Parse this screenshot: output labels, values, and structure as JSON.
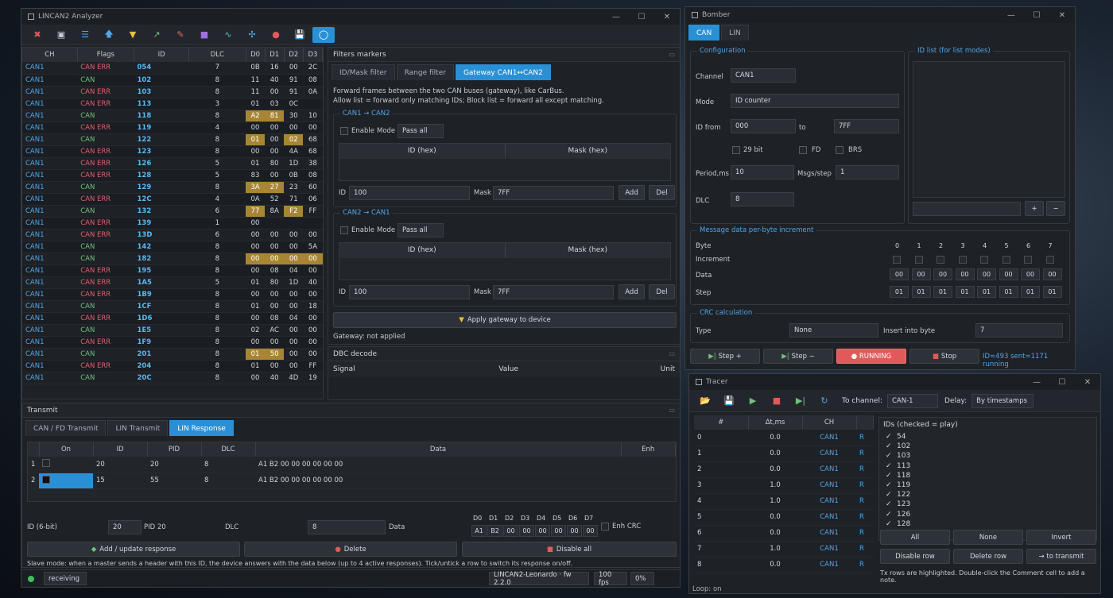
{
  "analyzer": {
    "title": "LINCAN2 Analyzer",
    "columns": [
      "CH",
      "Flags",
      "ID",
      "DLC",
      "D0",
      "D1",
      "D2",
      "D3"
    ],
    "rows": [
      [
        "CAN1",
        "CAN ERR",
        "054",
        "7",
        "0B",
        "16",
        "00",
        "2C"
      ],
      [
        "CAN1",
        "CAN",
        "102",
        "8",
        "11",
        "40",
        "91",
        "08"
      ],
      [
        "CAN1",
        "CAN ERR",
        "103",
        "8",
        "11",
        "00",
        "91",
        "0A"
      ],
      [
        "CAN1",
        "CAN ERR",
        "113",
        "3",
        "01",
        "03",
        "0C",
        ""
      ],
      [
        "CAN1",
        "CAN",
        "118",
        "8",
        "A2",
        "81",
        "30",
        "10"
      ],
      [
        "CAN1",
        "CAN ERR",
        "119",
        "4",
        "00",
        "00",
        "00",
        "00"
      ],
      [
        "CAN1",
        "CAN",
        "122",
        "8",
        "01",
        "00",
        "02",
        "68"
      ],
      [
        "CAN1",
        "CAN ERR",
        "123",
        "8",
        "00",
        "00",
        "4A",
        "68"
      ],
      [
        "CAN1",
        "CAN ERR",
        "126",
        "5",
        "01",
        "80",
        "1D",
        "38"
      ],
      [
        "CAN1",
        "CAN ERR",
        "128",
        "5",
        "83",
        "00",
        "0B",
        "08"
      ],
      [
        "CAN1",
        "CAN",
        "129",
        "8",
        "3A",
        "27",
        "23",
        "60"
      ],
      [
        "CAN1",
        "CAN ERR",
        "12C",
        "4",
        "0A",
        "52",
        "71",
        "06"
      ],
      [
        "CAN1",
        "CAN",
        "132",
        "6",
        "77",
        "8A",
        "F2",
        "FF"
      ],
      [
        "CAN1",
        "CAN ERR",
        "139",
        "1",
        "00",
        "",
        "",
        ""
      ],
      [
        "CAN1",
        "CAN ERR",
        "13D",
        "6",
        "00",
        "00",
        "00",
        "00"
      ],
      [
        "CAN1",
        "CAN",
        "142",
        "8",
        "00",
        "00",
        "00",
        "5A"
      ],
      [
        "CAN1",
        "CAN",
        "182",
        "8",
        "00",
        "00",
        "00",
        "00"
      ],
      [
        "CAN1",
        "CAN ERR",
        "195",
        "8",
        "00",
        "08",
        "04",
        "00"
      ],
      [
        "CAN1",
        "CAN ERR",
        "1A5",
        "5",
        "01",
        "80",
        "1D",
        "40"
      ],
      [
        "CAN1",
        "CAN ERR",
        "1B9",
        "8",
        "00",
        "00",
        "00",
        "00"
      ],
      [
        "CAN1",
        "CAN",
        "1CF",
        "8",
        "01",
        "00",
        "00",
        "18"
      ],
      [
        "CAN1",
        "CAN ERR",
        "1D6",
        "8",
        "00",
        "08",
        "04",
        "00"
      ],
      [
        "CAN1",
        "CAN",
        "1E5",
        "8",
        "02",
        "AC",
        "00",
        "00"
      ],
      [
        "CAN1",
        "CAN ERR",
        "1F9",
        "8",
        "00",
        "00",
        "00",
        "00"
      ],
      [
        "CAN1",
        "CAN",
        "201",
        "8",
        "01",
        "50",
        "00",
        "00"
      ],
      [
        "CAN1",
        "CAN ERR",
        "204",
        "8",
        "01",
        "00",
        "00",
        "FF"
      ],
      [
        "CAN1",
        "CAN",
        "20C",
        "8",
        "00",
        "40",
        "4D",
        "19"
      ]
    ],
    "filters": {
      "title": "Filters  markers",
      "tabs": [
        "ID/Mask filter",
        "Range filter",
        "Gateway CAN1↔CAN2"
      ],
      "desc1": "Forward frames between the two CAN buses (gateway), like CarBus.",
      "desc2": "Allow list = forward only matching IDs; Block list = forward all except matching.",
      "g1": "CAN1 → CAN2",
      "g2": "CAN2 → CAN1",
      "enable": "Enable",
      "mode": "Mode",
      "mode_val": "Pass all",
      "col_id": "ID (hex)",
      "col_mask": "Mask (hex)",
      "id_lbl": "ID",
      "id_val": "100",
      "mask_lbl": "Mask",
      "mask_val": "7FF",
      "add": "Add",
      "del": "Del",
      "apply": "Apply gateway to device",
      "status": "Gateway: not applied"
    },
    "dbc": {
      "title": "DBC decode",
      "cols": [
        "Signal",
        "Value",
        "Unit"
      ]
    },
    "transmit": {
      "title": "Transmit",
      "tabs": [
        "CAN / FD Transmit",
        "LIN Transmit",
        "LIN Response"
      ],
      "cols": [
        "On",
        "ID",
        "PID",
        "DLC",
        "Data",
        "Enh"
      ],
      "rows": [
        [
          "1",
          "",
          "20",
          "20",
          "8",
          "A1 B2 00 00 00 00 00 00"
        ],
        [
          "2",
          "",
          "15",
          "55",
          "8",
          "A1 B2 00 00 00 00 00 00"
        ]
      ],
      "id_lbl": "ID (6-bit)",
      "id_val": "20",
      "pid": "PID 20",
      "dlc_lbl": "DLC",
      "dlc_val": "8",
      "data_lbl": "Data",
      "bytes_hdr": [
        "D0",
        "D1",
        "D2",
        "D3",
        "D4",
        "D5",
        "D6",
        "D7"
      ],
      "bytes": [
        "A1",
        "B2",
        "00",
        "00",
        "00",
        "00",
        "00",
        "00"
      ],
      "enh": "Enh CRC",
      "add": "Add / update response",
      "delete": "Delete",
      "disable": "Disable all",
      "note": "Slave mode: when a master sends a header with this ID, the device answers with the data below (up to 4 active responses). Tick/untick a row to switch its response on/off."
    },
    "status": {
      "state": "receiving",
      "device": "LINCAN2-Leonardo · fw 2.2.0",
      "fps": "100 fps",
      "pct": "0%"
    }
  },
  "bomber": {
    "title": "Bomber",
    "tabs": [
      "CAN",
      "LIN"
    ],
    "config": "Configuration",
    "idlist": "ID list (for list modes)",
    "channel_lbl": "Channel",
    "channel": "CAN1",
    "mode_lbl": "Mode",
    "mode": "ID counter",
    "idfrom_lbl": "ID from",
    "idfrom": "000",
    "to_lbl": "to",
    "to": "7FF",
    "bit29": "29 bit",
    "fd": "FD",
    "brs": "BRS",
    "period_lbl": "Period,ms",
    "period": "10",
    "msgs_lbl": "Msgs/step",
    "msgs": "1",
    "dlc_lbl": "DLC",
    "dlc": "8",
    "plus": "+",
    "minus": "−",
    "msgdata": "Message data  per-byte increment",
    "byte_lbl": "Byte",
    "inc_lbl": "Increment",
    "data_lbl": "Data",
    "step_lbl": "Step",
    "byte_idx": [
      "0",
      "1",
      "2",
      "3",
      "4",
      "5",
      "6",
      "7"
    ],
    "data": [
      "00",
      "00",
      "00",
      "00",
      "00",
      "00",
      "00",
      "00"
    ],
    "step": [
      "01",
      "01",
      "01",
      "01",
      "01",
      "01",
      "01",
      "01"
    ],
    "crc": "CRC calculation",
    "type_lbl": "Type",
    "type": "None",
    "insert_lbl": "Insert into byte",
    "insert": "7",
    "step_plus": "Step +",
    "step_minus": "Step −",
    "running": "● RUNNING",
    "stop": "Stop",
    "stat": "ID=493  sent=1171  running"
  },
  "tracer": {
    "title": "Tracer",
    "to_channel_lbl": "To channel:",
    "to_channel": "CAN-1",
    "delay_lbl": "Delay:",
    "delay": "By timestamps",
    "cols": [
      "#",
      "Δt,ms",
      "CH"
    ],
    "rows": [
      [
        "0",
        "0.0",
        "CAN1"
      ],
      [
        "1",
        "0.0",
        "CAN1"
      ],
      [
        "2",
        "0.0",
        "CAN1"
      ],
      [
        "3",
        "1.0",
        "CAN1"
      ],
      [
        "4",
        "1.0",
        "CAN1"
      ],
      [
        "5",
        "0.0",
        "CAN1"
      ],
      [
        "6",
        "0.0",
        "CAN1"
      ],
      [
        "7",
        "1.0",
        "CAN1"
      ],
      [
        "8",
        "0.0",
        "CAN1"
      ]
    ],
    "ids_title": "IDs (checked = play)",
    "ids": [
      "54",
      "102",
      "103",
      "113",
      "118",
      "119",
      "122",
      "123",
      "126",
      "128"
    ],
    "all": "All",
    "none": "None",
    "invert": "Invert",
    "disable_row": "Disable row",
    "delete_row": "Delete row",
    "to_transmit": "→ to transmit",
    "note": "Tx rows are highlighted. Double-click the Comment cell to add a note.",
    "loop": "Loop: on"
  },
  "colors": {
    "accent": "#2a90d6",
    "err": "#e0606a",
    "ok": "#6fc27a",
    "highlight": "#a88534",
    "running": "#e05a5a"
  }
}
